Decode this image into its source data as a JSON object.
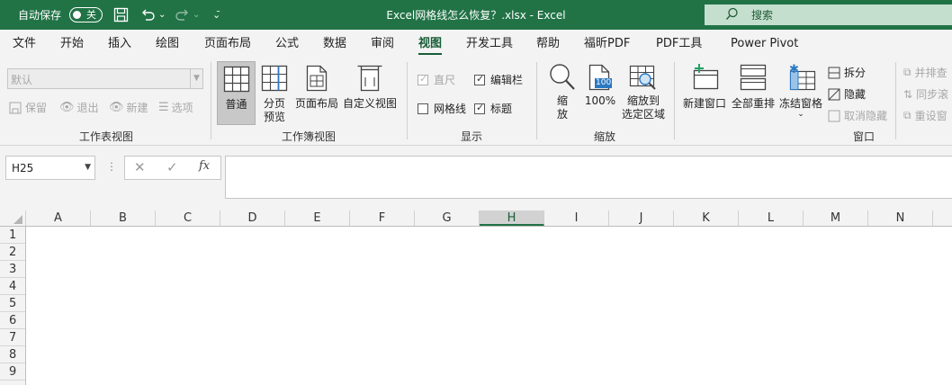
{
  "titlebar": {
    "autosave_label": "自动保存",
    "autosave_state": "关",
    "doc_title": "Excel网格线怎么恢复？.xlsx  -  Excel",
    "search_placeholder": "搜索",
    "accent_color": "#217346"
  },
  "tabs": [
    {
      "label": "文件"
    },
    {
      "label": "开始"
    },
    {
      "label": "插入"
    },
    {
      "label": "绘图"
    },
    {
      "label": "页面布局"
    },
    {
      "label": "公式"
    },
    {
      "label": "数据"
    },
    {
      "label": "审阅"
    },
    {
      "label": "视图",
      "active": true
    },
    {
      "label": "开发工具"
    },
    {
      "label": "帮助"
    },
    {
      "label": "福昕PDF"
    },
    {
      "label": "PDF工具"
    },
    {
      "label": "Power Pivot"
    }
  ],
  "ribbon": {
    "sheet_view": {
      "dropdown_value": "默认",
      "keep": "保留",
      "exit": "退出",
      "new": "新建",
      "options": "选项",
      "group_label": "工作表视图"
    },
    "workbook_view": {
      "normal": "普通",
      "page_break_1": "分页",
      "page_break_2": "预览",
      "page_layout": "页面布局",
      "custom": "自定义视图",
      "group_label": "工作簿视图"
    },
    "show": {
      "ruler": "直尺",
      "formula_bar": "编辑栏",
      "gridlines": "网格线",
      "headings": "标题",
      "ruler_checked": true,
      "formula_bar_checked": true,
      "gridlines_checked": false,
      "headings_checked": true,
      "group_label": "显示"
    },
    "zoom": {
      "zoom_1": "缩",
      "zoom_2": "放",
      "hundred": "100%",
      "hundred_icon": "100",
      "to_sel_1": "缩放到",
      "to_sel_2": "选定区域",
      "group_label": "缩放"
    },
    "window": {
      "new_window": "新建窗口",
      "arrange_all": "全部重排",
      "freeze": "冻结窗格",
      "split": "拆分",
      "hide": "隐藏",
      "unhide": "取消隐藏",
      "side_by_side": "并排查",
      "sync_scroll": "同步滚",
      "reset_pos": "重设窗",
      "group_label": "窗口"
    }
  },
  "formula_bar": {
    "name_box": "H25",
    "fx": "fx",
    "cancel": "✕",
    "enter": "✓",
    "content": ""
  },
  "grid": {
    "columns": [
      "A",
      "B",
      "C",
      "D",
      "E",
      "F",
      "G",
      "H",
      "I",
      "J",
      "K",
      "L",
      "M",
      "N"
    ],
    "selected_column": "H",
    "rows": [
      "1",
      "2",
      "3",
      "4",
      "5",
      "6",
      "7",
      "8",
      "9"
    ]
  }
}
